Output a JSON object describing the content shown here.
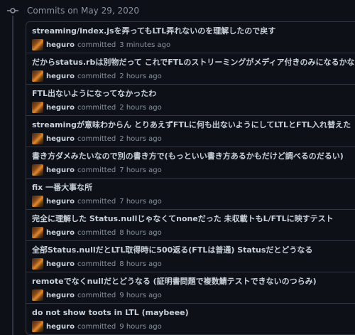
{
  "header": {
    "title": "Commits on May 29, 2020"
  },
  "commits": [
    {
      "message": "streaming/index.jsを弄ってもLTL弄れないのを理解したので戻す",
      "author": "heguro",
      "action": "committed",
      "time": "3 minutes ago"
    },
    {
      "message": "だからstatus.rbは別物だって これでFTLのストリーミングがメディア付きのみになるかな",
      "author": "heguro",
      "action": "committed",
      "time": "2 hours ago"
    },
    {
      "message": "FTL出ないようになってなかったわ",
      "author": "heguro",
      "action": "committed",
      "time": "2 hours ago"
    },
    {
      "message": "streamingが意味わからん とりあえずFTLに何も出ないようにしてLTLとFTL入れ替えた",
      "author": "heguro",
      "action": "committed",
      "time": "2 hours ago"
    },
    {
      "message": "書き方ダメみたいなので別の書き方で(もっといい書き方あるかもだけど調べるのだるい)",
      "author": "heguro",
      "action": "committed",
      "time": "7 hours ago"
    },
    {
      "message": "fix 一番大事な所",
      "author": "heguro",
      "action": "committed",
      "time": "7 hours ago"
    },
    {
      "message": "完全に理解した Status.nullじゃなくてnoneだった 未収載トもL/FTLに映すテスト",
      "author": "heguro",
      "action": "committed",
      "time": "8 hours ago"
    },
    {
      "message": "全部Status.nullだとLTL取得時に500返る(FTLは普通) Statusだとどうなる",
      "author": "heguro",
      "action": "committed",
      "time": "8 hours ago"
    },
    {
      "message": "remoteでなくnullだとどうなる (証明書問題で複数鯖テストできないのつらみ)",
      "author": "heguro",
      "action": "committed",
      "time": "9 hours ago"
    },
    {
      "message": "do not show toots in LTL (maybeee)",
      "author": "heguro",
      "action": "committed",
      "time": "9 hours ago"
    }
  ]
}
